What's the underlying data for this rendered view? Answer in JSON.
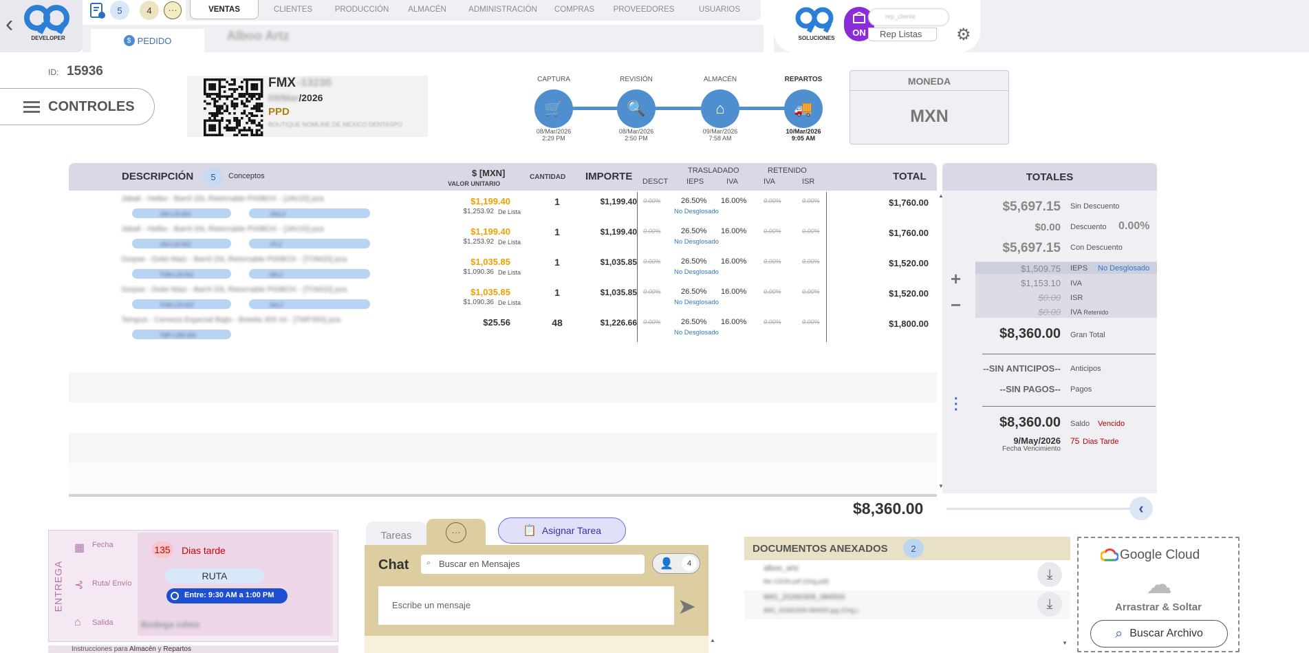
{
  "nav": {
    "badge_tasks": "5",
    "badge_msgs": "4",
    "tabs": [
      "VENTAS",
      "CLIENTES",
      "PRODUCCIÓN",
      "ALMACÉN",
      "ADMINISTRACIÓN",
      "COMPRAS",
      "PROVEEDORES",
      "USUARIOS"
    ],
    "active_tab": "VENTAS",
    "pedido_label": "PEDIDO",
    "client_name": "Alboo Artz",
    "logo_sub": "DEVELOPER"
  },
  "header_right": {
    "sol_label": "SOLUCIONES",
    "on_label": "ON",
    "user_placeholder": "rep_cliente",
    "rep_listas": "Rep Listas"
  },
  "doc": {
    "id_label": "ID:",
    "id": "15936",
    "controls_label": "CONTROLES",
    "fmx": "FMX",
    "fmx_num": "-13230",
    "date_prefix": "09/Mar",
    "date_suffix": "/2026",
    "ppd": "PPD",
    "address": "BOUTIQUE NOMLINE DE MEXICO DENTASPO"
  },
  "workflow": [
    {
      "label": "CAPTURA",
      "icon": "cart-icon",
      "date": "08/Mar/2026",
      "time": "2:29 PM"
    },
    {
      "label": "REVISIÓN",
      "icon": "review-icon",
      "date": "08/Mar/2026",
      "time": "2:50 PM"
    },
    {
      "label": "ALMACÉN",
      "icon": "warehouse-icon",
      "date": "09/Mar/2026",
      "time": "7:58 AM"
    },
    {
      "label": "REPARTOS",
      "icon": "truck-icon",
      "date": "10/Mar/2026",
      "time": "9:05 AM"
    }
  ],
  "moneda": {
    "label": "MONEDA",
    "value": "MXN"
  },
  "table": {
    "headers": {
      "descripcion": "DESCRIPCIÓN",
      "conceptos_count": "5",
      "conceptos": "Conceptos",
      "currency": "$ [MXN]",
      "valor": "VALOR UNITARIO",
      "cantidad": "CANTIDAD",
      "importe": "IMPORTE",
      "desct": "DESCT",
      "trasladado": "TRASLADADO",
      "ieps": "IEPS",
      "iva": "IVA",
      "retenido": "RETENIDO",
      "iva_r": "IVA",
      "isr": "ISR",
      "total": "TOTAL"
    },
    "de_lista": "De Lista",
    "no_desglosado": "No Desglosado",
    "rows": [
      {
        "desc": "Jabali - Helbo - Barril 20L Retornable P00BOX - [JAV20] pza",
        "pill1": "JAV-L20-001",
        "pill2": "JAVL2",
        "price": "$1,199.40",
        "list_price": "$1,253.92",
        "qty": "1",
        "importe": "$1,199.40",
        "desct": "0.00%",
        "ieps": "26.50%",
        "iva": "16.00%",
        "ret_iva": "0.00%",
        "isr": "0.00%",
        "total": "$1,760.00",
        "orange": true
      },
      {
        "desc": "Jabali - Helbo - Barril 20L Retornable P00BOX - [JAV20] pza",
        "pill1": "JAV-L20-002",
        "pill2": "JTL2",
        "price": "$1,199.40",
        "list_price": "$1,253.92",
        "qty": "1",
        "importe": "$1,199.40",
        "desct": "0.00%",
        "ieps": "26.50%",
        "iva": "16.00%",
        "ret_iva": "0.00%",
        "isr": "0.00%",
        "total": "$1,760.00",
        "orange": true
      },
      {
        "desc": "Sorpse - Dolei Maiz - Barril 20L Retornable P00BOX - [TOM20] pza",
        "pill1": "TOM-L20-001",
        "pill2": "SKL2",
        "price": "$1,035.85",
        "list_price": "$1,090.36",
        "qty": "1",
        "importe": "$1,035.85",
        "desct": "0.00%",
        "ieps": "26.50%",
        "iva": "16.00%",
        "ret_iva": "0.00%",
        "isr": "0.00%",
        "total": "$1,520.00",
        "orange": true
      },
      {
        "desc": "Sorpse - Dolei Maiz - Barril 20L Retornable P00BOX - [TOM20] pza",
        "pill1": "TOM-L20-002",
        "pill2": "SKL2",
        "price": "$1,035.85",
        "list_price": "$1,090.36",
        "qty": "1",
        "importe": "$1,035.85",
        "desct": "0.00%",
        "ieps": "26.50%",
        "iva": "16.00%",
        "ret_iva": "0.00%",
        "isr": "0.00%",
        "total": "$1,520.00",
        "orange": true
      },
      {
        "desc": "Tempus - Cerveza Especial Bajio - Botella 355 ml - [TMP355] pza",
        "pill1": "TMP-L355-001",
        "pill2": "",
        "price": "$25.56",
        "list_price": "",
        "qty": "48",
        "importe": "$1,226.66",
        "desct": "0.00%",
        "ieps": "26.50%",
        "iva": "16.00%",
        "ret_iva": "0.00%",
        "isr": "0.00%",
        "total": "$1,800.00",
        "orange": false
      }
    ]
  },
  "totales": {
    "title": "TOTALES",
    "sin_descuento": "$5,697.15",
    "sin_descuento_lbl": "Sin Descuento",
    "descuento": "$0.00",
    "descuento_lbl": "Descuento",
    "descuento_pct": "0.00%",
    "con_descuento": "$5,697.15",
    "con_descuento_lbl": "Con Descuento",
    "ieps": "$1,509.75",
    "ieps_lbl": "IEPS",
    "ieps_note": "No Desglosado",
    "iva": "$1,153.10",
    "iva_lbl": "IVA",
    "isr": "$0.00",
    "isr_lbl": "ISR",
    "iva_ret": "$0.00",
    "iva_ret_lbl": "IVA",
    "iva_ret_sub": "Retenido",
    "gran_total": "$8,360.00",
    "gran_total_lbl": "Gran Total",
    "anticipos_val": "--SIN ANTICIPOS--",
    "anticipos_lbl": "Anticipos",
    "pagos_val": "--SIN PAGOS--",
    "pagos_lbl": "Pagos",
    "saldo": "$8,360.00",
    "saldo_lbl": "Saldo",
    "vencido": "Vencido",
    "venc_date": "9/May/2026",
    "venc_lbl": "Fecha Vencimiento",
    "dias_num": "75",
    "dias_lbl": "Dias Tarde"
  },
  "grand_total": "$8,360.00",
  "entrega": {
    "title": "ENTREGA",
    "fecha_lbl": "Fecha",
    "ruta_lbl": "Ruta/ Envío",
    "salida_lbl": "Salida",
    "dias_num": "135",
    "dias_lbl": "Dias tarde",
    "ruta": "RUTA",
    "entre": "Entre: 9:30 AM a 1:00 PM",
    "bodega": "Bodega cdmx",
    "instr_a": "Instrucciones para ",
    "instr_b": "Almacén",
    "instr_c": " y ",
    "instr_d": "Repartos"
  },
  "chat": {
    "tareas_tab": "Tareas",
    "asignar": "Asignar Tarea",
    "title": "Chat",
    "search_placeholder": "Buscar en Mensajes",
    "participants": "4",
    "msg_placeholder": "Escribe un mensaje"
  },
  "docs": {
    "title": "DOCUMENTOS ANEXADOS",
    "count": "2",
    "items": [
      {
        "name": "alboo_artz",
        "sub": "file-13230.pdf (Orig.pdf)"
      },
      {
        "name": "IMG_20260309_084500",
        "sub": "IMG_20260309-084500.jpg (Orig.)"
      }
    ]
  },
  "upload": {
    "brand": "Google Cloud",
    "drag": "Arrastrar & Soltar",
    "search": "Buscar Archivo"
  }
}
